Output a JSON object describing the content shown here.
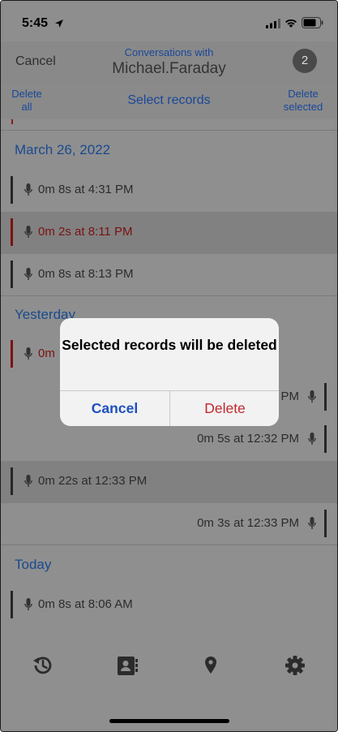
{
  "status": {
    "time": "5:45"
  },
  "header": {
    "cancel": "Cancel",
    "subtitle": "Conversations with",
    "contact": "Michael.Faraday",
    "badge": "2"
  },
  "actions": {
    "delete_all": "Delete all",
    "select_records": "Select records",
    "delete_selected": "Delete selected"
  },
  "groups": [
    {
      "date": "March 26, 2022",
      "records": [
        {
          "text": "0m 8s at 4:31 PM",
          "side": "left",
          "selected": false,
          "red": false
        },
        {
          "text": "0m 2s at 8:11 PM",
          "side": "left",
          "selected": true,
          "red": true
        },
        {
          "text": "0m 8s at 8:13 PM",
          "side": "left",
          "selected": false,
          "red": false
        }
      ]
    },
    {
      "date": "Yesterday",
      "records": [
        {
          "text": "0m",
          "side": "left",
          "selected": false,
          "red": true
        },
        {
          "text": "PM",
          "side": "right",
          "selected": false,
          "red": false
        },
        {
          "text": "0m 5s at 12:32 PM",
          "side": "right",
          "selected": false,
          "red": false
        },
        {
          "text": "0m 22s at 12:33 PM",
          "side": "left",
          "selected": true,
          "red": false
        },
        {
          "text": "0m 3s at 12:33 PM",
          "side": "right",
          "selected": false,
          "red": false
        }
      ]
    },
    {
      "date": "Today",
      "records": [
        {
          "text": "0m 8s at 8:06 AM",
          "side": "left",
          "selected": false,
          "red": false
        }
      ]
    }
  ],
  "dialog": {
    "message": "Selected records will be deleted",
    "cancel": "Cancel",
    "delete": "Delete"
  },
  "tabs": [
    "history-icon",
    "contacts-icon",
    "location-icon",
    "settings-icon"
  ]
}
